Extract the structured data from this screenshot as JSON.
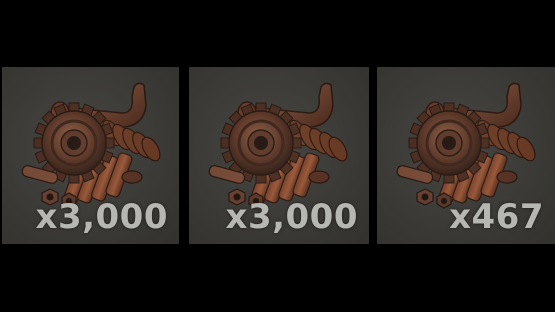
{
  "inventory": {
    "slots": [
      {
        "item_icon": "metal-fragments-gear-icon",
        "quantity": "x3,000"
      },
      {
        "item_icon": "metal-fragments-gear-icon",
        "quantity": "x3,000"
      },
      {
        "item_icon": "metal-fragments-gear-icon",
        "quantity": "x467"
      }
    ]
  },
  "colors": {
    "background": "#000000",
    "slot_background": "#3d3c38",
    "quantity_text": "#b6b6b2",
    "rust": "#6e3a22"
  }
}
